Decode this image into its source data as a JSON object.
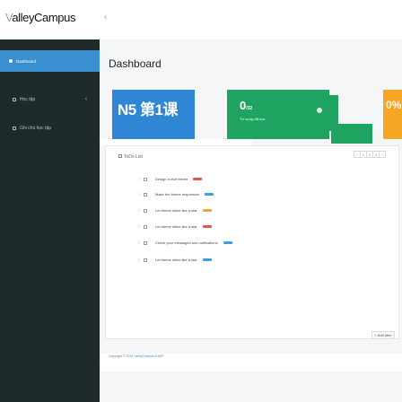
{
  "app": {
    "logo_prefix": "V",
    "logo_rest": "alleyCampus",
    "toggle_icon": "chevron-left"
  },
  "sidebar": {
    "items": [
      {
        "label": "Dashboard",
        "icon": "circle-icon",
        "active": true
      },
      {
        "label": "Học tập",
        "icon": "book-icon",
        "chevron": "‹"
      },
      {
        "label": "Ghi chú học tập",
        "icon": "note-icon"
      }
    ]
  },
  "main": {
    "title": "Dashboard",
    "course_card": {
      "name": "N5 第1课",
      "color": "#2f86d4"
    },
    "count_card": {
      "value": "0",
      "suffix": "/32",
      "label": "Từ vựng đã học",
      "color": "#1ea460"
    },
    "percent_card": {
      "value": "0%",
      "color": "#f5a623"
    }
  },
  "todo": {
    "header": "ToDo List",
    "pages": [
      "‹",
      "1",
      "2",
      "3",
      "›"
    ],
    "items": [
      {
        "text": "Design a nice theme",
        "badge_color": "#e25555"
      },
      {
        "text": "Make the theme responsive",
        "badge_color": "#3aa0e0"
      },
      {
        "text": "Let theme shine like a star",
        "badge_color": "#f0a630"
      },
      {
        "text": "Let theme shine like a star",
        "badge_color": "#e25555"
      },
      {
        "text": "Check your messages and notifications",
        "badge_color": "#3aa0e0"
      },
      {
        "text": "Let theme shine like a star",
        "badge_color": "#3aa0e0"
      }
    ],
    "add_label": "+ Add item"
  },
  "footer": {
    "prefix": "Copyright © 2018",
    "brand": "ValleyCampus",
    "suffix": "& ASP"
  }
}
